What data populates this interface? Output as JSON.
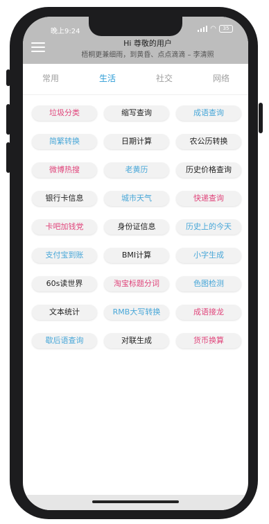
{
  "status_bar": {
    "time": "晚上9:24",
    "battery": "35"
  },
  "header": {
    "greeting": "Hi 尊敬的用户",
    "quote": "梧桐更兼细雨，到黄昏、点点滴滴 – 李清照"
  },
  "tabs": [
    {
      "label": "常用",
      "active": false
    },
    {
      "label": "生活",
      "active": true
    },
    {
      "label": "社交",
      "active": false
    },
    {
      "label": "网络",
      "active": false
    }
  ],
  "tools": [
    {
      "label": "垃圾分类",
      "color": "pink"
    },
    {
      "label": "缩写查询",
      "color": "dark"
    },
    {
      "label": "成语查询",
      "color": "blue"
    },
    {
      "label": "简繁转换",
      "color": "blue"
    },
    {
      "label": "日期计算",
      "color": "dark"
    },
    {
      "label": "农公历转换",
      "color": "dark"
    },
    {
      "label": "微博热搜",
      "color": "pink"
    },
    {
      "label": "老黄历",
      "color": "blue"
    },
    {
      "label": "历史价格查询",
      "color": "dark"
    },
    {
      "label": "银行卡信息",
      "color": "dark"
    },
    {
      "label": "城市天气",
      "color": "blue"
    },
    {
      "label": "快递查询",
      "color": "pink"
    },
    {
      "label": "卡吧加钱党",
      "color": "pink"
    },
    {
      "label": "身份证信息",
      "color": "dark"
    },
    {
      "label": "历史上的今天",
      "color": "blue"
    },
    {
      "label": "支付宝到账",
      "color": "blue"
    },
    {
      "label": "BMI计算",
      "color": "dark"
    },
    {
      "label": "小字生成",
      "color": "blue"
    },
    {
      "label": "60s读世界",
      "color": "dark"
    },
    {
      "label": "淘宝标题分词",
      "color": "pink"
    },
    {
      "label": "色图检测",
      "color": "blue"
    },
    {
      "label": "文本统计",
      "color": "dark"
    },
    {
      "label": "RMB大写转换",
      "color": "blue"
    },
    {
      "label": "成语接龙",
      "color": "pink"
    },
    {
      "label": "歇后语查询",
      "color": "blue"
    },
    {
      "label": "对联生成",
      "color": "dark"
    },
    {
      "label": "货币换算",
      "color": "pink"
    }
  ],
  "colors": {
    "pink": "#e0457b",
    "blue": "#48a7d8",
    "dark": "#222222",
    "tab_active": "#2a9bd6",
    "header_bg": "#bdbdbd"
  }
}
